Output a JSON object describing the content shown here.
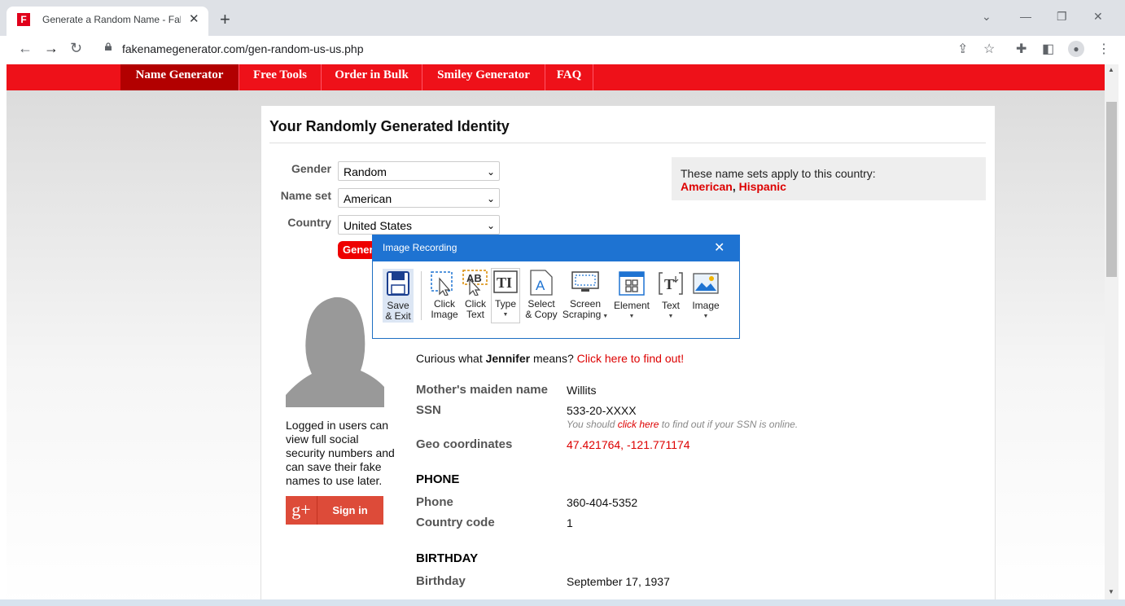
{
  "browser": {
    "tab_title": "Generate a Random Name - Fake",
    "url": "fakenamegenerator.com/gen-random-us-us.php"
  },
  "nav": {
    "items": [
      "Name Generator",
      "Free Tools",
      "Order in Bulk",
      "Smiley Generator",
      "FAQ"
    ]
  },
  "page": {
    "title": "Your Randomly Generated Identity",
    "form": {
      "gender_label": "Gender",
      "gender_value": "Random",
      "nameset_label": "Name set",
      "nameset_value": "American",
      "country_label": "Country",
      "country_value": "United States",
      "generate_label": "Generate"
    },
    "info": {
      "text": "These name sets apply to this country:",
      "link1": "American",
      "link2": "Hispanic"
    },
    "sidebar": {
      "note": "Logged in users can view full social security numbers and can save their fake names to use later.",
      "signin_label": "Sign in"
    },
    "curious": {
      "prefix": "Curious what ",
      "name": "Jennifer",
      "middle": " means? ",
      "link": "Click here to find out!"
    },
    "details": {
      "maiden_label": "Mother's maiden name",
      "maiden_value": "Willits",
      "ssn_label": "SSN",
      "ssn_value": "533-20-XXXX",
      "ssn_note_prefix": "You should ",
      "ssn_note_link": "click here",
      "ssn_note_suffix": " to find out if your SSN is online.",
      "geo_label": "Geo coordinates",
      "geo_value": "47.421764, -121.771174"
    },
    "phone": {
      "section": "PHONE",
      "phone_label": "Phone",
      "phone_value": "360-404-5352",
      "cc_label": "Country code",
      "cc_value": "1"
    },
    "birthday": {
      "section": "BIRTHDAY",
      "birthday_label": "Birthday",
      "birthday_value": "September 17, 1937"
    }
  },
  "dialog": {
    "title": "Image Recording",
    "buttons": {
      "save": [
        "Save",
        "& Exit"
      ],
      "click_image": [
        "Click",
        "Image"
      ],
      "click_text": [
        "Click",
        "Text"
      ],
      "type": "Type",
      "select_copy": [
        "Select",
        "& Copy"
      ],
      "screen_scraping": [
        "Screen",
        "Scraping"
      ],
      "element": "Element",
      "text": "Text",
      "image": "Image"
    }
  },
  "colors": {
    "brand_red": "#ee1119",
    "dialog_blue": "#1e73d2",
    "link_red": "#dd0000"
  }
}
